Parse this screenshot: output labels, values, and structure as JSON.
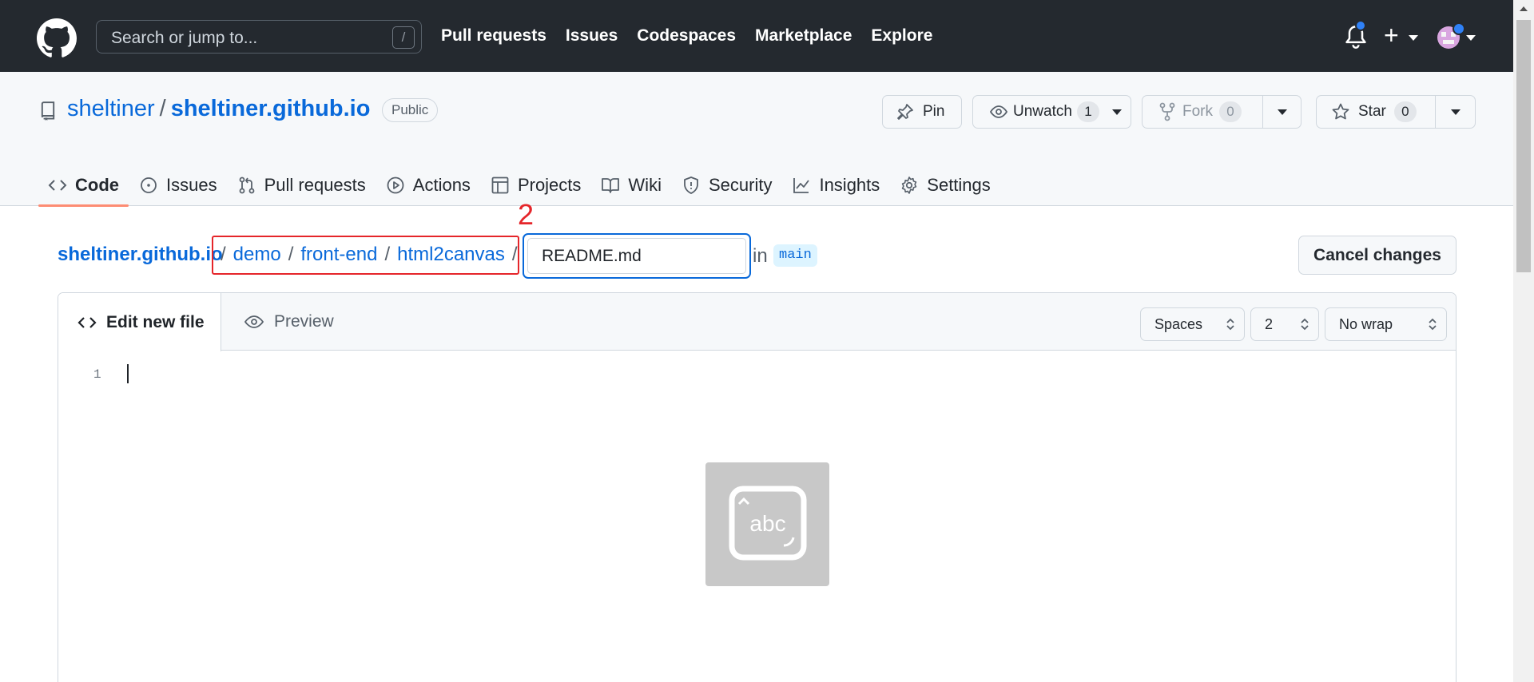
{
  "header": {
    "search_placeholder": "Search or jump to...",
    "search_shortcut": "/",
    "nav": [
      "Pull requests",
      "Issues",
      "Codespaces",
      "Marketplace",
      "Explore"
    ],
    "icons": [
      "github-logo-icon",
      "bell-icon",
      "plus-icon",
      "avatar"
    ]
  },
  "repo": {
    "owner": "sheltiner",
    "separator": "/",
    "name": "sheltiner.github.io",
    "visibility": "Public",
    "actions": {
      "pin": "Pin",
      "unwatch": "Unwatch",
      "watch_count": "1",
      "fork": "Fork",
      "fork_count": "0",
      "star": "Star",
      "star_count": "0"
    },
    "tabs": [
      "Code",
      "Issues",
      "Pull requests",
      "Actions",
      "Projects",
      "Wiki",
      "Security",
      "Insights",
      "Settings"
    ],
    "active_tab": "Code"
  },
  "breadcrumb": {
    "root": "sheltiner.github.io",
    "segments": [
      "demo",
      "front-end",
      "html2canvas"
    ],
    "separator": "/",
    "filename": "README.md",
    "in_label": "in",
    "branch": "main",
    "annotation": "2"
  },
  "cancel_label": "Cancel changes",
  "editor": {
    "tabs": [
      "Edit new file",
      "Preview"
    ],
    "indent_mode": "Spaces",
    "indent_size": "2",
    "wrap_mode": "No wrap",
    "line_number": "1",
    "ime_label": "abc"
  },
  "colors": {
    "header_bg": "#24292f",
    "link": "#0969da",
    "active_tab_underline": "#fd8c73",
    "annotation_red": "#e5252a",
    "focus_blue": "#0969da"
  }
}
